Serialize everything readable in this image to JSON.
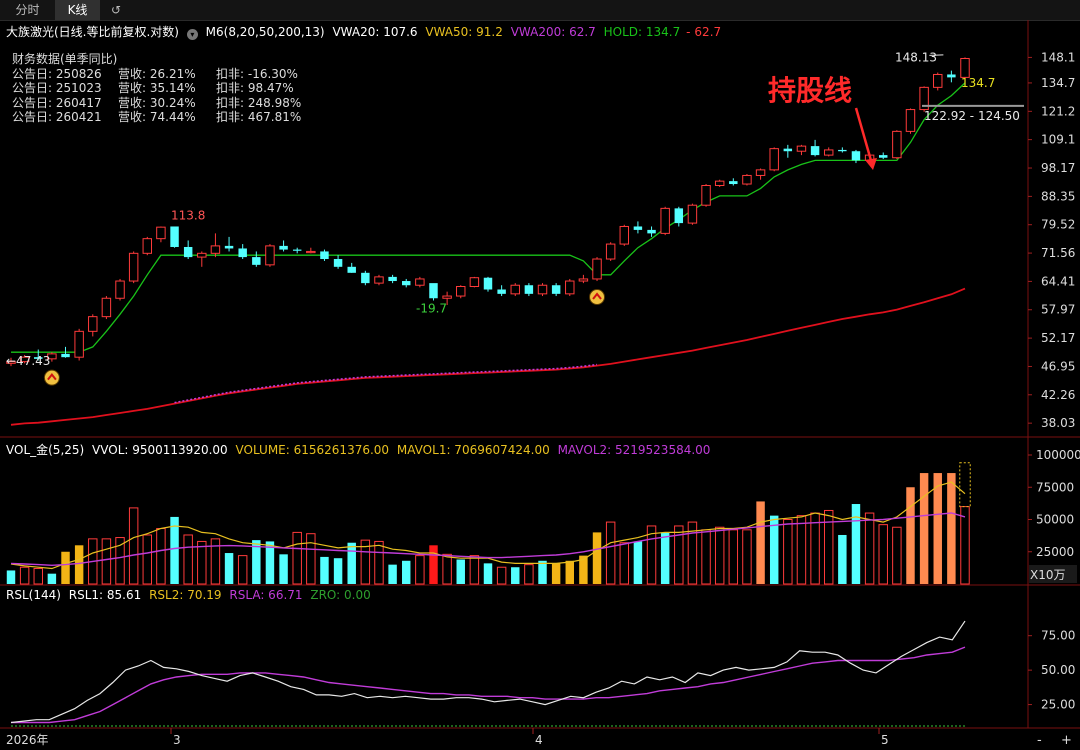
{
  "tabs": [
    "分时",
    "K线"
  ],
  "header": {
    "title": "大族激光(日线.等比前复权.对数)",
    "ma": "M6(8,20,50,200,13)",
    "vwa20": "VWA20: 107.6",
    "vwa50": "VWA50: 91.2",
    "vwa200": "VWA200: 62.7",
    "hold": "HOLD: 134.7",
    "hold_red": "62.7"
  },
  "colors": {
    "up": "#ff3b3b",
    "down": "#54ffff",
    "hold": "#19c219",
    "vwa200": "#e0101d",
    "vwa50": "#e8c020",
    "purple": "#c03cd8",
    "white": "#e8e8e8",
    "zro": "#2e9e2e"
  },
  "financial": {
    "title": "财务数据(单季同比)",
    "rows": [
      {
        "date": "公告日: 250826",
        "rev": "营收:  26.21%",
        "np": "扣非:  -16.30%"
      },
      {
        "date": "公告日: 251023",
        "rev": "营收:  35.14%",
        "np": "扣非:  98.47%"
      },
      {
        "date": "公告日: 260417",
        "rev": "营收:  30.24%",
        "np": "扣非:  248.98%"
      },
      {
        "date": "公告日: 260421",
        "rev": "营收:  74.44%",
        "np": "扣非:  467.81%"
      }
    ]
  },
  "annotations": {
    "holdline": "持股线",
    "high_label": "148.13",
    "hold_label": "134.7",
    "range_label": "122.92 - 124.50",
    "peak_label": "113.8",
    "trough_label": "-19.7",
    "low_label": "47.43"
  },
  "vol_header": {
    "name": "VOL_金(5,25)",
    "vvol": "VVOL: 9500113920.00",
    "volume": "VOLUME: 6156261376.00",
    "mavol1": "MAVOL1: 7069607424.00",
    "mavol2": "MAVOL2: 5219523584.00"
  },
  "rsl_header": {
    "name": "RSL(144)",
    "rsl1": "RSL1: 85.61",
    "rsl2": "RSL2: 70.19",
    "rsla": "RSLA: 66.71",
    "zro": "ZRO: 0.00"
  },
  "vol_unit": "X10万",
  "x_axis": {
    "labels": [
      "2026年",
      "3",
      "4",
      "5"
    ]
  },
  "bottom_controls": {
    "minus": "-",
    "plus": "+"
  },
  "chart_data": [
    {
      "type": "candlestick",
      "scale": "log",
      "ylim": [
        36.8,
        158
      ],
      "y_ticks": [
        "148.1",
        "134.7",
        "121.2",
        "109.1",
        "98.17",
        "88.35",
        "79.52",
        "71.56",
        "64.41",
        "57.97",
        "52.17",
        "46.95",
        "42.26",
        "38.03"
      ],
      "y_tick_values": [
        148.1,
        134.7,
        121.2,
        109.1,
        98.17,
        88.35,
        79.52,
        71.56,
        64.41,
        57.97,
        52.17,
        46.95,
        42.26,
        38.03
      ],
      "ohlc": [
        [
          47.5,
          48.5,
          47.0,
          47.8
        ],
        [
          47.8,
          49.0,
          47.5,
          48.6
        ],
        [
          48.6,
          50.0,
          48.0,
          48.3
        ],
        [
          48.3,
          49.5,
          47.8,
          49.2
        ],
        [
          49.2,
          50.5,
          48.5,
          48.6
        ],
        [
          48.6,
          54.0,
          48.0,
          53.5
        ],
        [
          53.5,
          57.0,
          52.5,
          56.5
        ],
        [
          56.5,
          61.0,
          56.0,
          60.5
        ],
        [
          60.5,
          65.0,
          60.0,
          64.5
        ],
        [
          64.5,
          72.0,
          64.0,
          71.5
        ],
        [
          71.5,
          76.0,
          71.0,
          75.5
        ],
        [
          75.5,
          79.0,
          74.5,
          78.8
        ],
        [
          79.0,
          77.5,
          73.0,
          73.2
        ],
        [
          73.2,
          75.0,
          70.0,
          70.5
        ],
        [
          70.5,
          72.0,
          68.0,
          71.5
        ],
        [
          71.5,
          77.0,
          70.5,
          73.5
        ],
        [
          73.5,
          76.0,
          72.0,
          72.8
        ],
        [
          72.8,
          74.0,
          70.0,
          70.5
        ],
        [
          70.5,
          72.0,
          68.0,
          68.5
        ],
        [
          68.5,
          74.0,
          68.0,
          73.5
        ],
        [
          73.5,
          75.0,
          72.0,
          72.5
        ],
        [
          72.5,
          73.0,
          71.5,
          72.4
        ],
        [
          72.0,
          73.0,
          71.5,
          72.0
        ],
        [
          72.0,
          72.5,
          69.5,
          70.0
        ],
        [
          70.0,
          71.0,
          67.5,
          68.0
        ],
        [
          68.0,
          69.0,
          66.5,
          66.5
        ],
        [
          66.5,
          67.0,
          63.5,
          64.0
        ],
        [
          64.0,
          66.0,
          63.5,
          65.5
        ],
        [
          65.5,
          66.0,
          64.0,
          64.5
        ],
        [
          64.5,
          65.0,
          63.0,
          63.5
        ],
        [
          63.5,
          65.5,
          63.0,
          65.0
        ],
        [
          64.0,
          63.5,
          60.0,
          60.5
        ],
        [
          60.5,
          62.0,
          59.0,
          61.0
        ],
        [
          61.0,
          63.5,
          60.5,
          63.2
        ],
        [
          63.2,
          65.5,
          63.0,
          65.3
        ],
        [
          65.3,
          65.5,
          62.0,
          62.5
        ],
        [
          62.5,
          63.5,
          61.0,
          61.5
        ],
        [
          61.5,
          64.0,
          61.0,
          63.5
        ],
        [
          63.5,
          64.0,
          61.0,
          61.5
        ],
        [
          61.5,
          64.0,
          61.0,
          63.5
        ],
        [
          63.5,
          64.0,
          61.0,
          61.5
        ],
        [
          61.5,
          65.0,
          61.0,
          64.5
        ],
        [
          64.5,
          66.0,
          64.0,
          65.0
        ],
        [
          65.0,
          70.5,
          64.5,
          70.0
        ],
        [
          70.0,
          74.5,
          69.5,
          74.0
        ],
        [
          74.0,
          79.5,
          73.5,
          79.0
        ],
        [
          79.0,
          80.5,
          77.0,
          78.0
        ],
        [
          78.0,
          79.0,
          76.0,
          77.0
        ],
        [
          77.0,
          85.0,
          76.5,
          84.5
        ],
        [
          84.5,
          85.0,
          79.0,
          80.0
        ],
        [
          80.0,
          86.0,
          79.5,
          85.5
        ],
        [
          85.5,
          92.5,
          85.0,
          92.0
        ],
        [
          92.0,
          94.0,
          91.5,
          93.5
        ],
        [
          93.5,
          94.5,
          92.0,
          92.5
        ],
        [
          92.5,
          96.0,
          92.0,
          95.5
        ],
        [
          95.5,
          98.0,
          94.0,
          97.5
        ],
        [
          97.5,
          106.0,
          97.0,
          105.5
        ],
        [
          105.5,
          107.0,
          102.0,
          104.5
        ],
        [
          104.5,
          107.0,
          103.0,
          106.5
        ],
        [
          106.5,
          109.0,
          102.5,
          103.0
        ],
        [
          103.0,
          106.0,
          102.5,
          105.0
        ],
        [
          105.0,
          106.0,
          104.0,
          104.5
        ],
        [
          104.5,
          105.0,
          100.0,
          101.0
        ],
        [
          101.0,
          103.5,
          100.5,
          103.0
        ],
        [
          103.0,
          104.0,
          101.5,
          102.0
        ],
        [
          102.0,
          113.0,
          101.5,
          112.5
        ],
        [
          112.5,
          122.5,
          111.5,
          122.0
        ],
        [
          122.0,
          133.0,
          121.0,
          132.5
        ],
        [
          132.5,
          140.0,
          131.0,
          139.0
        ],
        [
          139.0,
          141.0,
          135.0,
          137.5
        ],
        [
          137.5,
          148.13,
          137.0,
          147.5
        ]
      ],
      "hold_line": [
        49.5,
        49.5,
        49.5,
        49.5,
        49.5,
        49.5,
        50.5,
        53.5,
        57.0,
        61.0,
        66.0,
        71.0,
        71.0,
        71.0,
        71.0,
        71.0,
        71.0,
        71.0,
        71.0,
        71.0,
        71.0,
        71.0,
        71.0,
        71.0,
        71.0,
        71.0,
        71.0,
        71.0,
        71.0,
        71.0,
        71.0,
        71.0,
        71.0,
        71.0,
        71.0,
        71.0,
        71.0,
        71.0,
        71.0,
        71.0,
        71.0,
        71.0,
        69.5,
        66.0,
        66.0,
        69.5,
        73.0,
        75.5,
        78.5,
        81.0,
        84.0,
        86.5,
        88.5,
        88.5,
        88.5,
        91.0,
        95.0,
        97.5,
        99.5,
        101.0,
        101.0,
        101.0,
        101.0,
        101.0,
        101.0,
        101.0,
        108.0,
        117.5,
        124.0,
        128.5,
        134.7
      ],
      "vwa200": [
        37.8,
        38.0,
        38.1,
        38.3,
        38.5,
        38.7,
        38.9,
        39.2,
        39.5,
        39.8,
        40.1,
        40.5,
        40.9,
        41.3,
        41.7,
        42.1,
        42.5,
        42.8,
        43.1,
        43.4,
        43.7,
        44.0,
        44.2,
        44.4,
        44.6,
        44.8,
        45.0,
        45.1,
        45.2,
        45.3,
        45.4,
        45.5,
        45.6,
        45.7,
        45.8,
        45.9,
        46.0,
        46.1,
        46.2,
        46.3,
        46.4,
        46.6,
        46.8,
        47.1,
        47.4,
        47.8,
        48.2,
        48.6,
        49.0,
        49.4,
        49.8,
        50.3,
        50.8,
        51.3,
        51.8,
        52.4,
        53.0,
        53.6,
        54.2,
        54.8,
        55.4,
        56.0,
        56.5,
        57.0,
        57.4,
        58.0,
        58.8,
        59.6,
        60.5,
        61.4,
        62.7
      ],
      "markers": [
        {
          "index": 3,
          "label": "buy"
        },
        {
          "index": 43,
          "label": "buy"
        }
      ]
    },
    {
      "type": "bar",
      "title": "VOL_金(5,25)",
      "ylim": [
        0,
        100000
      ],
      "y_ticks": [
        "100000",
        "75000",
        "50000",
        "25000"
      ],
      "y_tick_values": [
        100000,
        75000,
        50000,
        25000
      ],
      "unit": "X10万",
      "values": [
        10500,
        13000,
        12000,
        8000,
        25000,
        30000,
        35000,
        35000,
        36000,
        59000,
        38000,
        43000,
        52000,
        38000,
        33000,
        35000,
        24000,
        22000,
        34000,
        33000,
        23000,
        40000,
        39000,
        21000,
        20000,
        32000,
        34000,
        33000,
        15000,
        18000,
        22000,
        30000,
        23000,
        19000,
        22000,
        16000,
        13000,
        13000,
        15000,
        18000,
        16000,
        18000,
        22000,
        40000,
        48000,
        32000,
        33000,
        45000,
        40000,
        45000,
        48000,
        42000,
        44000,
        42000,
        42000,
        64000,
        53000,
        50000,
        53000,
        55000,
        57000,
        38000,
        62000,
        55000,
        46000,
        44000,
        75000,
        86000,
        86000,
        86000,
        60000
      ],
      "colors": [
        "cyan",
        "up",
        "up",
        "cyan",
        "gold",
        "gold",
        "up",
        "up",
        "up",
        "up",
        "up",
        "up",
        "cyan",
        "up",
        "up",
        "up",
        "cyan",
        "up",
        "cyan",
        "cyan",
        "cyan",
        "up",
        "up",
        "cyan",
        "cyan",
        "cyan",
        "up",
        "up",
        "cyan",
        "cyan",
        "up",
        "red",
        "up",
        "cyan",
        "up",
        "cyan",
        "up",
        "cyan",
        "up",
        "cyan",
        "gold",
        "gold",
        "gold",
        "gold",
        "up",
        "up",
        "cyan",
        "up",
        "cyan",
        "up",
        "up",
        "up",
        "up",
        "up",
        "up",
        "orange",
        "cyan",
        "up",
        "up",
        "up",
        "up",
        "cyan",
        "cyan",
        "up",
        "up",
        "up",
        "orange",
        "orange",
        "orange",
        "orange",
        "up"
      ],
      "mavol1": [
        15500,
        14000,
        13000,
        12000,
        16000,
        19000,
        24000,
        27000,
        30000,
        36000,
        39000,
        43000,
        45000,
        44000,
        40000,
        39000,
        35000,
        32000,
        31000,
        30000,
        28000,
        31000,
        32000,
        30000,
        28000,
        29000,
        29000,
        30000,
        27000,
        26000,
        24000,
        24000,
        21000,
        20000,
        20000,
        20000,
        17000,
        16000,
        16000,
        16000,
        16000,
        17000,
        19000,
        26000,
        32000,
        34000,
        36000,
        39000,
        40000,
        40000,
        41000,
        42000,
        43000,
        43000,
        44000,
        48000,
        50000,
        51000,
        52000,
        55000,
        53000,
        50000,
        52000,
        50000,
        48000,
        52000,
        60000,
        68000,
        76000,
        79000,
        70000
      ],
      "mavol2": [
        16000,
        15500,
        15000,
        14500,
        15000,
        16000,
        17500,
        19000,
        20500,
        22500,
        24000,
        26000,
        27500,
        28500,
        29000,
        29500,
        29800,
        29500,
        29000,
        28500,
        28000,
        27500,
        27000,
        26500,
        26000,
        25500,
        25000,
        24500,
        24000,
        23500,
        23000,
        22500,
        22000,
        21500,
        21000,
        20500,
        20500,
        21000,
        21500,
        22000,
        22500,
        23500,
        25000,
        27000,
        29000,
        31000,
        33000,
        35000,
        36500,
        38000,
        39500,
        40500,
        41500,
        42500,
        43500,
        44500,
        45500,
        46500,
        47000,
        47500,
        48000,
        48500,
        49000,
        49500,
        50000,
        51000,
        52000,
        53000,
        54000,
        55000,
        52000
      ]
    },
    {
      "type": "line",
      "title": "RSL(144)",
      "ylim": [
        8,
        98
      ],
      "y_ticks": [
        "75.00",
        "50.00",
        "25.00"
      ],
      "y_tick_values": [
        75,
        50,
        25
      ],
      "series": [
        {
          "name": "RSL1",
          "values": [
            12,
            13,
            14,
            14,
            18,
            22,
            28,
            33,
            41,
            50,
            53,
            57,
            52,
            51,
            49,
            46,
            44,
            42,
            46,
            48,
            45,
            42,
            38,
            36,
            32,
            32,
            31,
            33,
            30,
            31,
            30,
            31,
            30,
            29,
            29,
            30,
            30,
            29,
            27,
            28,
            29,
            27,
            25,
            28,
            31,
            30,
            34,
            37,
            42,
            40,
            45,
            43,
            45,
            41,
            48,
            46,
            50,
            52,
            50,
            51,
            52,
            56,
            64,
            63,
            63,
            61,
            55,
            50,
            48,
            54,
            60,
            65,
            70,
            74,
            72,
            85.61
          ]
        },
        {
          "name": "RSLA",
          "values": [
            12,
            12,
            12,
            12,
            13,
            14,
            17,
            20,
            25,
            30,
            35,
            40,
            43,
            45,
            46,
            47,
            47,
            47,
            48,
            48,
            48,
            47,
            46,
            45,
            43,
            41,
            40,
            39,
            38,
            37,
            36,
            35,
            34,
            33,
            33,
            32,
            32,
            31,
            31,
            31,
            30,
            30,
            29,
            29,
            29,
            29,
            30,
            30,
            31,
            32,
            33,
            35,
            36,
            37,
            38,
            40,
            41,
            43,
            45,
            47,
            49,
            51,
            53,
            55,
            56,
            57,
            57,
            57,
            57,
            57,
            58,
            59,
            61,
            62,
            63,
            66.71
          ]
        }
      ]
    }
  ]
}
